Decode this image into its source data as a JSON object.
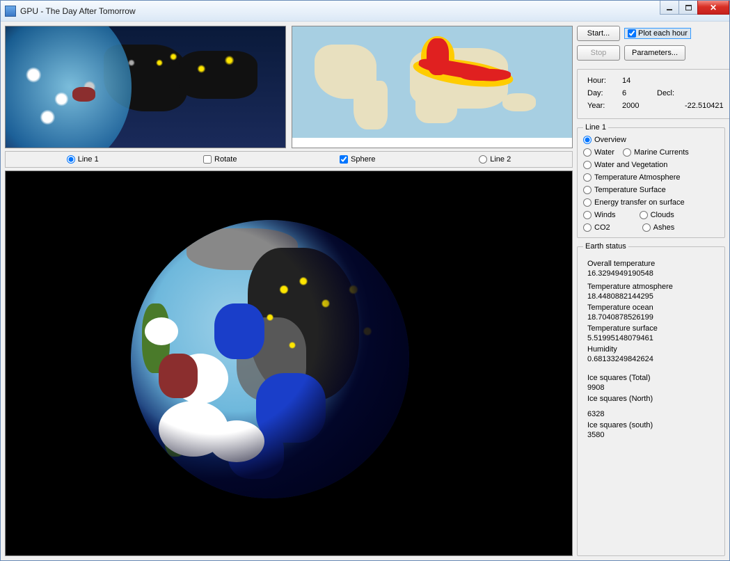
{
  "window": {
    "title": "GPU - The Day After Tomorrow"
  },
  "controls": {
    "start": "Start...",
    "stop": "Stop",
    "parameters": "Parameters...",
    "plot_each_hour": "Plot each hour"
  },
  "time": {
    "hour_label": "Hour:",
    "hour": "14",
    "day_label": "Day:",
    "day": "6",
    "year_label": "Year:",
    "year": "2000",
    "decl_label": "Decl:",
    "decl": "-22.510421"
  },
  "view_bar": {
    "line1": "Line 1",
    "rotate": "Rotate",
    "sphere": "Sphere",
    "line2": "Line 2"
  },
  "line1_group": {
    "legend": "Line 1",
    "overview": "Overview",
    "water": "Water",
    "marine_currents": "Marine Currents",
    "water_and_vegetation": "Water and Vegetation",
    "temperature_atmosphere": "Temperature Atmosphere",
    "temperature_surface": "Temperature Surface",
    "energy_transfer": "Energy transfer on surface",
    "winds": "Winds",
    "clouds": "Clouds",
    "co2": "CO2",
    "ashes": "Ashes"
  },
  "earth_status": {
    "legend": "Earth status",
    "overall_temp_label": "Overall temperature",
    "overall_temp": "16.3294949190548",
    "temp_atm_label": "Temperature atmosphere",
    "temp_atm": "18.4480882144295",
    "temp_ocean_label": "Temperature ocean",
    "temp_ocean": "18.7040878526199",
    "temp_surface_label": "Temperature surface",
    "temp_surface": "5.51995148079461",
    "humidity_label": "Humidity",
    "humidity": "0.68133249842624",
    "ice_total_label": "Ice squares (Total)",
    "ice_total": "9908",
    "ice_north_label": "Ice squares (North)",
    "ice_north": "6328",
    "ice_south_label": "Ice squares (south)",
    "ice_south": "3580"
  }
}
